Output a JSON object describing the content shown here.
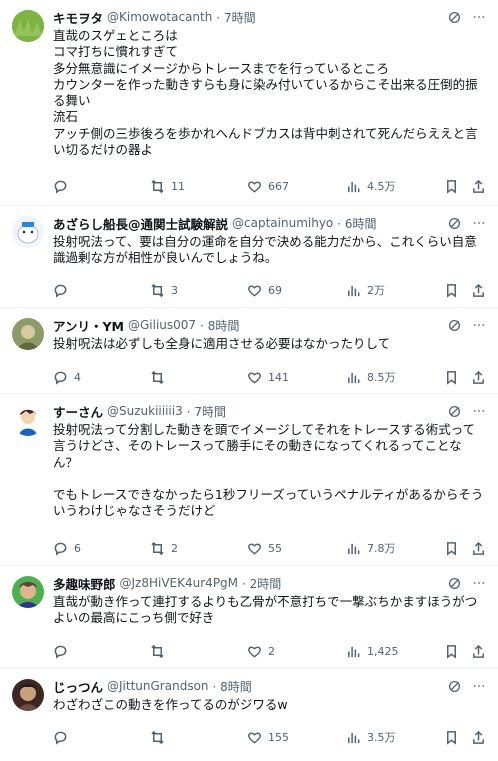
{
  "tweets": [
    {
      "name": "キモヲタ",
      "handle": "@Kimowotacanth",
      "time": "· 7時間",
      "text": "直哉のスゲェところは\nコマ打ちに慣れすぎて\n多分無意識にイメージからトレースまでを行っているところ\nカウンターを作った動きすらも身に染み付いているからこそ出来る圧倒的振る舞い\n流石\nアッチ側の三歩後ろを歩かれへんドブカスは背中刺されて死んだらええと言い切るだけの器よ",
      "replies": "",
      "reposts": "11",
      "likes": "667",
      "views": "4.5万"
    },
    {
      "name": "あざらし船長@通関士試験解説",
      "handle": "@captainumihyo",
      "time": "· 6時間",
      "text": "投射呪法って、要は自分の運命を自分で決める能力だから、これくらい自意識過剰な方が相性が良いんでしょうね。",
      "replies": "",
      "reposts": "3",
      "likes": "69",
      "views": "2万"
    },
    {
      "name": "アンリ・YM",
      "handle": "@Gilius007",
      "time": "· 8時間",
      "text": "投射呪法は必ずしも全身に適用させる必要はなかったりして",
      "replies": "4",
      "reposts": "",
      "likes": "141",
      "views": "8.5万"
    },
    {
      "name": "すーさん",
      "handle": "@Suzukiiiiii3",
      "time": "· 7時間",
      "text": "投射呪法って分割した動きを頭でイメージしてそれをトレースする術式って言うけどさ、そのトレースって勝手にその動きになってくれるってことなん？\n\nでもトレースできなかったら1秒フリーズっていうペナルティがあるからそういうわけじゃなさそうだけど",
      "replies": "6",
      "reposts": "2",
      "likes": "55",
      "views": "7.8万"
    },
    {
      "name": "多趣味野郎",
      "handle": "@Jz8HiVEK4ur4PgM",
      "time": "· 2時間",
      "text": "直哉が動き作って連打するよりも乙骨が不意打ちで一撃ぶちかますほうがつよいの最高にこっち側で好き",
      "replies": "",
      "reposts": "",
      "likes": "2",
      "views": "1,425"
    },
    {
      "name": "じっつん",
      "handle": "@JittunGrandson",
      "time": "· 8時間",
      "text": "わざわざこの動きを作ってるのがジワるw",
      "replies": "",
      "reposts": "",
      "likes": "155",
      "views": "3.5万"
    }
  ]
}
